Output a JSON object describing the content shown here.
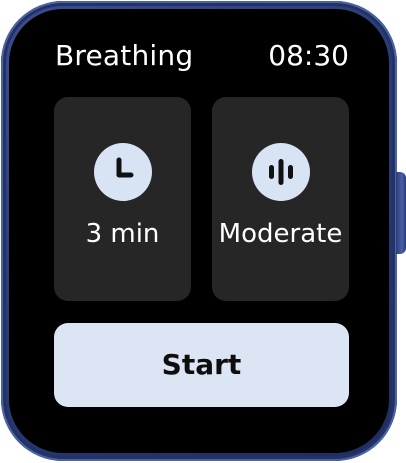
{
  "header": {
    "title": "Breathing",
    "time": "08:30"
  },
  "options": {
    "duration": {
      "label": "3 min",
      "icon": "clock-icon"
    },
    "intensity": {
      "label": "Moderate",
      "icon": "intensity-bars-icon"
    }
  },
  "start_button": {
    "label": "Start"
  },
  "colors": {
    "watch_case": "#2f4385",
    "screen_background": "#000000",
    "tile_background": "#262626",
    "accent_light": "#dbe5f3",
    "text_primary": "#ffffff"
  }
}
